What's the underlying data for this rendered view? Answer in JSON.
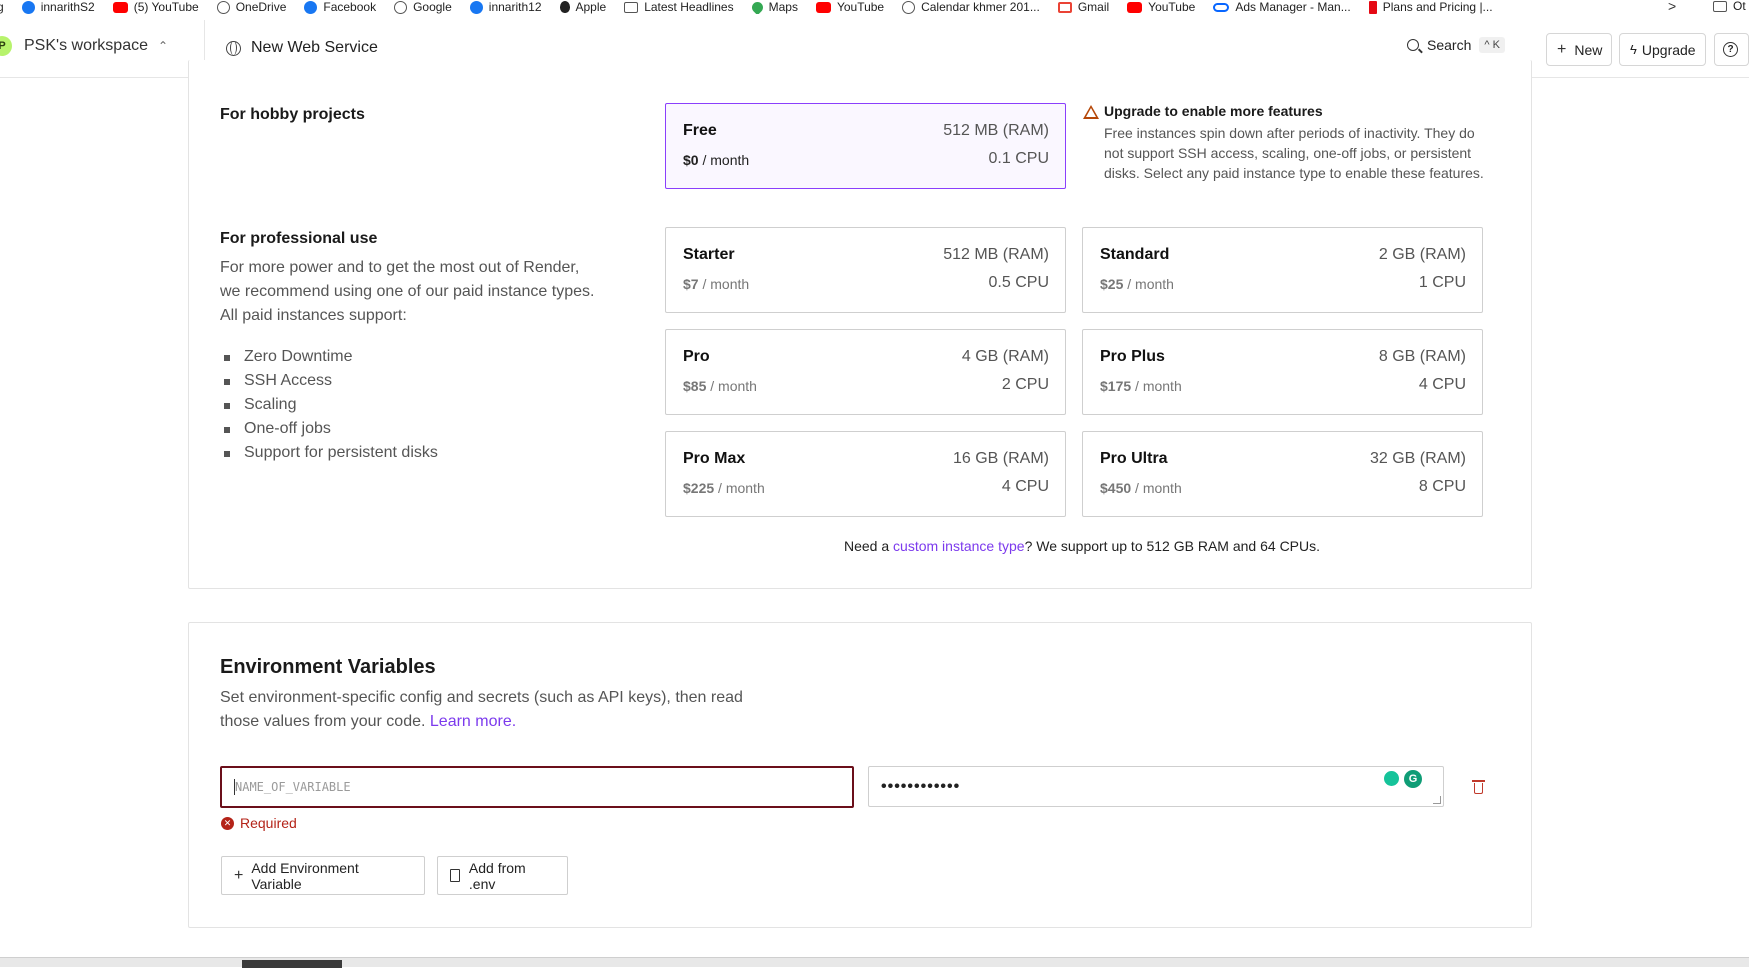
{
  "bookmarks": {
    "items": [
      {
        "label": "g",
        "icon": "none"
      },
      {
        "label": "innarithS2",
        "icon": "facebook-icon"
      },
      {
        "label": "(5) YouTube",
        "icon": "youtube-icon"
      },
      {
        "label": "OneDrive",
        "icon": "globe-icon"
      },
      {
        "label": "Facebook",
        "icon": "facebook-icon"
      },
      {
        "label": "Google",
        "icon": "globe-icon"
      },
      {
        "label": "innarith12",
        "icon": "facebook-icon"
      },
      {
        "label": "Apple",
        "icon": "apple-icon"
      },
      {
        "label": "Latest Headlines",
        "icon": "folder-icon"
      },
      {
        "label": "Maps",
        "icon": "maps-icon"
      },
      {
        "label": "YouTube",
        "icon": "youtube-icon"
      },
      {
        "label": "Calendar khmer 201...",
        "icon": "globe-icon"
      },
      {
        "label": "Gmail",
        "icon": "gmail-icon"
      },
      {
        "label": "YouTube",
        "icon": "youtube-icon"
      },
      {
        "label": "Ads Manager - Man...",
        "icon": "meta-icon"
      },
      {
        "label": "Plans and Pricing |...",
        "icon": "netflix-icon"
      }
    ],
    "more": ">",
    "other": "Ot"
  },
  "header": {
    "workspace_initial": "P",
    "workspace_name": "PSK's workspace",
    "breadcrumb": "New Web Service",
    "search_label": "Search",
    "search_shortcut": "^ K",
    "new_label": "New",
    "upgrade_label": "Upgrade",
    "help_glyph": "?"
  },
  "instance": {
    "hobby_heading": "For hobby projects",
    "pro_heading": "For professional use",
    "pro_description": "For more power and to get the most out of Render, we recommend using one of our paid instance types. All paid instances support:",
    "features": [
      "Zero Downtime",
      "SSH Access",
      "Scaling",
      "One-off jobs",
      "Support for persistent disks"
    ],
    "price_suffix": "/ month",
    "free": {
      "name": "Free",
      "ram": "512 MB (RAM)",
      "price": "$0",
      "cpu": "0.1 CPU"
    },
    "paid": [
      {
        "name": "Starter",
        "ram": "512 MB (RAM)",
        "price": "$7",
        "cpu": "0.5 CPU"
      },
      {
        "name": "Standard",
        "ram": "2 GB (RAM)",
        "price": "$25",
        "cpu": "1 CPU"
      },
      {
        "name": "Pro",
        "ram": "4 GB (RAM)",
        "price": "$85",
        "cpu": "2 CPU"
      },
      {
        "name": "Pro Plus",
        "ram": "8 GB (RAM)",
        "price": "$175",
        "cpu": "4 CPU"
      },
      {
        "name": "Pro Max",
        "ram": "16 GB (RAM)",
        "price": "$225",
        "cpu": "4 CPU"
      },
      {
        "name": "Pro Ultra",
        "ram": "32 GB (RAM)",
        "price": "$450",
        "cpu": "8 CPU"
      }
    ],
    "warning_title": "Upgrade to enable more features",
    "warning_body": "Free instances spin down after periods of inactivity. They do not support SSH access, scaling, one-off jobs, or persistent disks. Select any paid instance type to enable these features.",
    "custom_prefix": "Need a ",
    "custom_link": "custom instance type",
    "custom_suffix": "? We support up to 512 GB RAM and 64 CPUs."
  },
  "env": {
    "title": "Environment Variables",
    "description": "Set environment-specific config and secrets (such as API keys), then read those values from your code. ",
    "learn_more": "Learn more.",
    "key_placeholder": "NAME_OF_VARIABLE",
    "value_masked": "••••••••••••",
    "required_text": "Required",
    "add_button": "Add Environment Variable",
    "add_env_button": "Add from .env"
  },
  "colors": {
    "accent": "#8a3ffc",
    "link": "#7c3aed",
    "error": "#b42318",
    "warning": "#b54708"
  }
}
